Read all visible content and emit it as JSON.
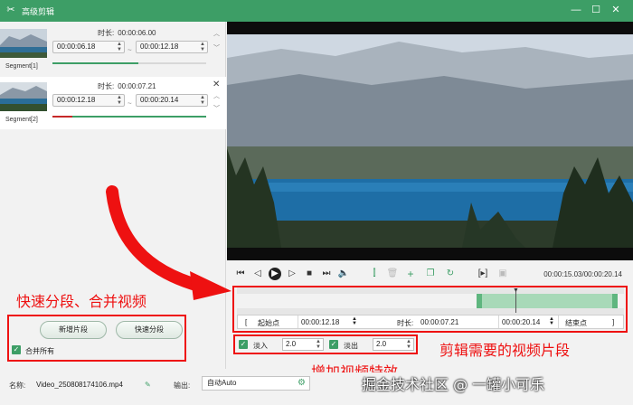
{
  "titlebar": {
    "app_icon": "scissors-app-icon",
    "title": "高级剪辑",
    "minimize": "—",
    "maximize": "☐",
    "close": "✕"
  },
  "segments": [
    {
      "name": "Segment[1]",
      "duration_label": "时长:",
      "duration": "00:00:06.00",
      "start": "00:00:06.18",
      "end": "00:00:12.18",
      "progress": 0.56
    },
    {
      "name": "Segment[2]",
      "duration_label": "时长:",
      "duration": "00:00:07.21",
      "start": "00:00:12.18",
      "end": "00:00:20.14",
      "progress": 1.0
    }
  ],
  "segment_dash": "~",
  "left_actions": {
    "add_segment": "新增片段",
    "quick_split": "快速分段",
    "merge_all_label": "合并所有",
    "merge_all_checked": true
  },
  "annotations": {
    "quick_split_merge": "快速分段、合并视频",
    "add_effects": "增加视频特效",
    "clip_segment": "剪辑需要的视频片段"
  },
  "player": {
    "time_current": "00:00:15.03",
    "time_total": "00:00:20.14",
    "time_sep": "/",
    "controls": [
      "prev-frame-icon",
      "step-back-icon",
      "play-icon",
      "step-forward-icon",
      "stop-icon",
      "next-frame-icon",
      "volume-icon",
      "split-icon",
      "delete-icon",
      "add-icon",
      "copy-icon",
      "undo-icon",
      "bracket-icon",
      "crop-icon"
    ]
  },
  "timeline": {
    "range_start_fraction": 0.62,
    "range_end_fraction": 0.985,
    "playhead_fraction": 0.72
  },
  "range": {
    "start_bracket": "[",
    "start_label": "起始点",
    "start_value": "00:00:12.18",
    "duration_label": "时长:",
    "duration_value": "00:00:07.21",
    "end_value": "00:00:20.14",
    "end_label": "结束点",
    "end_bracket": "]"
  },
  "effects": {
    "fade_in_label": "淡入",
    "fade_in_value": "2.0",
    "fade_in_checked": true,
    "fade_out_label": "淡出",
    "fade_out_value": "2.0",
    "fade_out_checked": true
  },
  "bottom": {
    "name_label": "名称:",
    "file_name": "Video_250808174106.mp4",
    "output_label": "输出:",
    "output_value": "自动Auto"
  },
  "watermark": "掘金技术社区 @ 一罐小可乐",
  "colors": {
    "accent": "#3d9e66",
    "annotation": "#ee1111"
  }
}
